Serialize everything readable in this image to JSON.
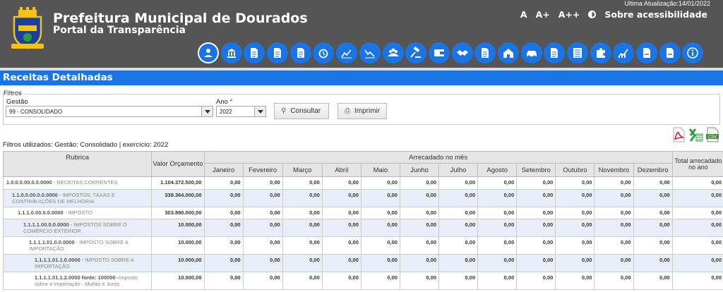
{
  "header": {
    "org_title": "Prefeitura Municipal de Dourados",
    "org_subtitle": "Portal da Transparência",
    "last_update": "Ultima Atualização:14/01/2022",
    "a11y": {
      "a": "A",
      "a_plus": "A+",
      "a_plus_plus": "A++",
      "about": "Sobre acessibilidade"
    }
  },
  "nav_icons": [
    "people-icon",
    "bank-icon",
    "document-icon",
    "document-icon",
    "document-icon",
    "alarm-icon",
    "chart-up-icon",
    "chart-down-icon",
    "group-icon",
    "gavel-icon",
    "wallet-icon",
    "handshake-icon",
    "document-icon",
    "house-icon",
    "car-icon",
    "document-icon",
    "list-icon",
    "puzzle-icon",
    "trend-icon",
    "file-icon",
    "file-icon",
    "info-icon"
  ],
  "page_title": "Receitas Detalhadas",
  "filters": {
    "legend": "Filtros",
    "gestao_label": "Gestão",
    "gestao_value": "99 - CONSOLIDADO",
    "ano_label": "Ano",
    "ano_required": "*",
    "ano_value": "2022",
    "consultar": "Consultar",
    "imprimir": "Imprimir"
  },
  "filters_used": "Filtros utilizados: Gestão: Consolidado | exercício: 2022",
  "exports": [
    "pdf-icon",
    "xls-icon",
    "csv-icon"
  ],
  "table": {
    "col_rubrica": "Rubrica",
    "col_valor": "Valor Orçamento",
    "col_arrecadado": "Arrecadado no mês",
    "months": [
      "Janeiro",
      "Fevereiro",
      "Março",
      "Abril",
      "Maio",
      "Junho",
      "Julho",
      "Agosto",
      "Setembro",
      "Outubro",
      "Novembro",
      "Dezembro"
    ],
    "col_total": "Total arrecadado no ano",
    "rows": [
      {
        "code": "1.0.0.0.00.0.0.0000",
        "desc": " - RECEITAS CORRENTES",
        "valor": "1.104.372.500,00",
        "zero": "0,00"
      },
      {
        "code": "1.1.0.0.00.0.0.0000",
        "desc": " - IMPOSTOS, TAXAS E CONTRIBUIÇÕES DE MELHORIA",
        "valor": "338.364.000,00",
        "zero": "0,00"
      },
      {
        "code": "1.1.1.0.00.0.0.0000",
        "desc": " - IMPOSTO",
        "valor": "303.890.000,00",
        "zero": "0,00"
      },
      {
        "code": "1.1.1.1.00.0.0.0000",
        "desc": " - IMPOSTOS SOBRE O COMÉRCIO EXTERIOR",
        "valor": "10.000,00",
        "zero": "0,00"
      },
      {
        "code": "1.1.1.1.01.0.0.0000",
        "desc": " - IMPOSTO SOBRE A IMPORTAÇÃO",
        "valor": "10.000,00",
        "zero": "0,00"
      },
      {
        "code": "1.1.1.1.01.1.0.0000",
        "desc": " - IMPOSTO SOBRE A IMPORTAÇÃO",
        "valor": "10.000,00",
        "zero": "0,00"
      },
      {
        "code": "1.1.1.1.01.1.2.0000 fonte: 100000 -",
        "desc": "Imposto sobre a Importação - Multas e Juros",
        "valor": "10.000,00",
        "zero": "0,00"
      }
    ]
  },
  "colors": {
    "header_bg": "#555555",
    "accent": "#1a74e4",
    "row_alt": "#e8eef8"
  }
}
